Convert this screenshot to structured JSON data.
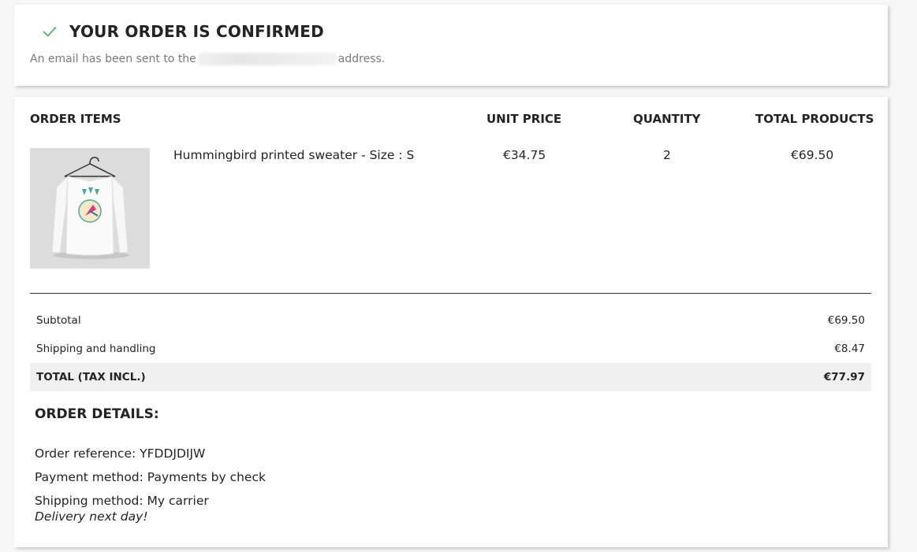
{
  "confirmation": {
    "title": "YOUR ORDER IS CONFIRMED",
    "email_prefix": "An email has been sent to the",
    "email_suffix": "address."
  },
  "order_table": {
    "headers": {
      "items": "ORDER ITEMS",
      "unit_price": "UNIT PRICE",
      "quantity": "QUANTITY",
      "total_products": "TOTAL PRODUCTS"
    },
    "items": [
      {
        "name": "Hummingbird printed sweater - Size : S",
        "unit_price": "€34.75",
        "quantity": "2",
        "total": "€69.50"
      }
    ]
  },
  "summary": {
    "subtotal_label": "Subtotal",
    "subtotal_value": "€69.50",
    "shipping_label": "Shipping and handling",
    "shipping_value": "€8.47",
    "total_label": "TOTAL (TAX INCL.)",
    "total_value": "€77.97"
  },
  "details": {
    "title": "ORDER DETAILS:",
    "reference": "Order reference: YFDDJDIJW",
    "payment": "Payment method: Payments by check",
    "shipping": "Shipping method: My carrier",
    "delivery_note": "Delivery next day!"
  },
  "colors": {
    "check": "#4cbb6c",
    "card_bg": "#ffffff",
    "page_bg": "#f6f6f6",
    "total_row_bg": "#f0f0f0"
  },
  "icons": {
    "check": "check-icon"
  }
}
